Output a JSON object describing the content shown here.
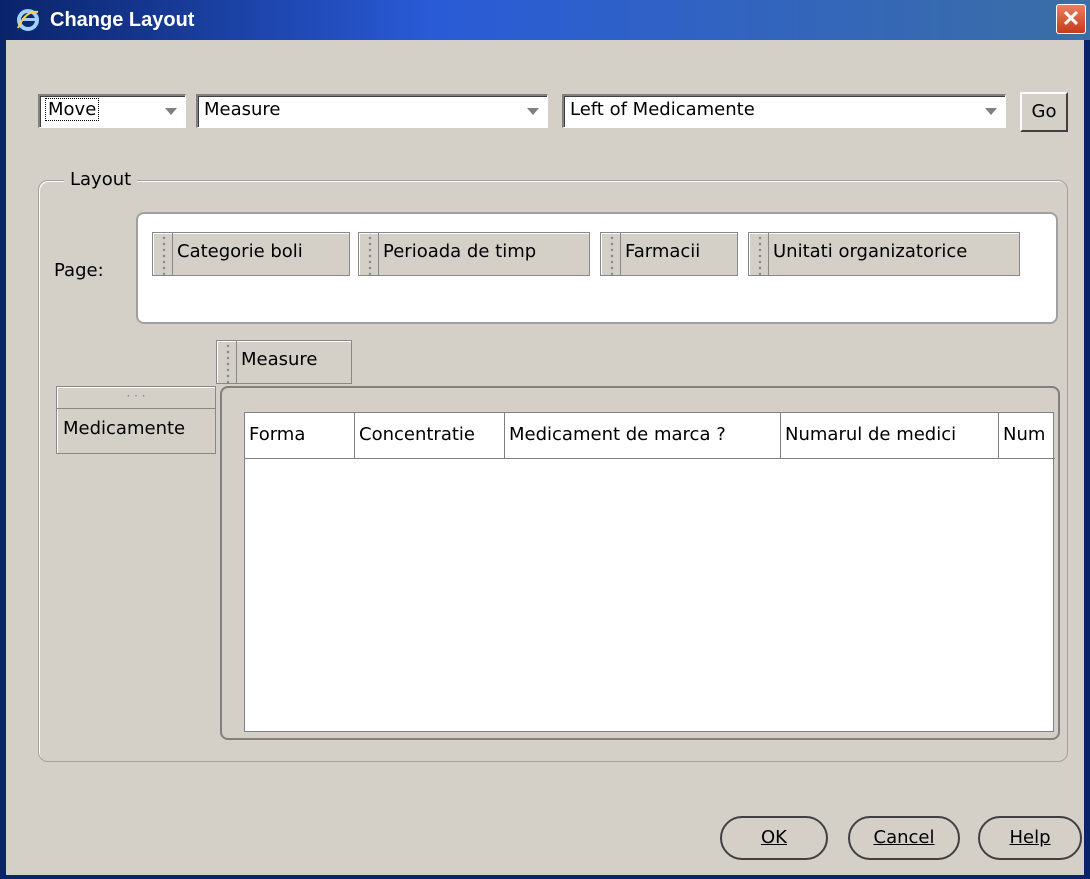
{
  "window": {
    "title": "Change Layout"
  },
  "toolbar": {
    "action_select": "Move",
    "item_select": "Measure",
    "position_select": "Left of Medicamente",
    "go_label": "Go"
  },
  "layout": {
    "legend": "Layout",
    "page_label": "Page:",
    "page_items": [
      "Categorie boli",
      "Perioada de timp",
      "Farmacii",
      "Unitati organizatorice"
    ],
    "column_edge_item": "Measure",
    "row_edge_item": "Medicamente",
    "table_columns": [
      "Forma",
      "Concentratie",
      "Medicament de marca ?",
      "Numarul de medici",
      "Num"
    ]
  },
  "footer": {
    "ok_label": "OK",
    "cancel_label": "Cancel",
    "help_label": "Help"
  },
  "colors": {
    "dialog_bg": "#d4d0c8",
    "titlebar": "#2a5bd7",
    "close_button": "#c8391a"
  }
}
